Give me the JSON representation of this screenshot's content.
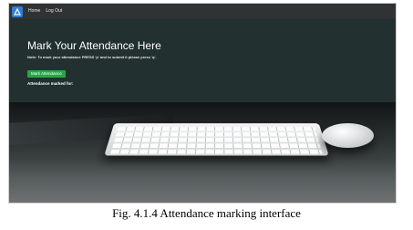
{
  "navbar": {
    "logo_icon": "triangle-logo-icon",
    "links": [
      "Home",
      "Log Out"
    ]
  },
  "hero": {
    "title": "Mark Your Attendance Here",
    "note": "Note: To mark your attendance PRESS 'p' and to submit it please press 'q'.",
    "button_label": "Mark Attendance",
    "marked_label": "Attendance marked for:"
  },
  "caption": "Fig. 4.1.4 Attendance marking interface",
  "colors": {
    "navbar": "#2f3334",
    "hero_background": "#22302f",
    "button": "#28a745",
    "logo": "#2e7dd7"
  }
}
